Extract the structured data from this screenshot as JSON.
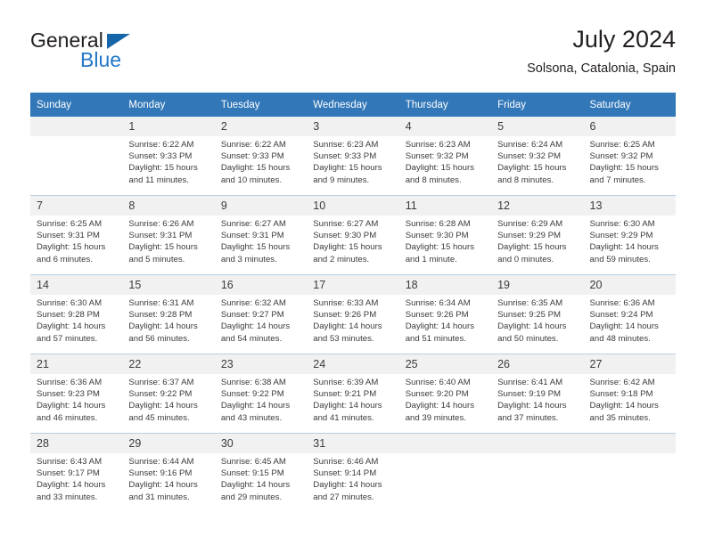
{
  "brand": {
    "name_part1": "General",
    "name_part2": "Blue"
  },
  "header": {
    "title": "July 2024",
    "subtitle": "Solsona, Catalonia, Spain"
  },
  "colors": {
    "header_blue": "#3277b8",
    "logo_blue": "#2277c8",
    "daynum_band": "#f1f1f1",
    "row_divider": "#b9cfe2"
  },
  "weekday_headers": [
    "Sunday",
    "Monday",
    "Tuesday",
    "Wednesday",
    "Thursday",
    "Friday",
    "Saturday"
  ],
  "weeks": [
    [
      {
        "day": "",
        "sunrise": "",
        "sunset": "",
        "daylight_1": "",
        "daylight_2": ""
      },
      {
        "day": "1",
        "sunrise": "Sunrise: 6:22 AM",
        "sunset": "Sunset: 9:33 PM",
        "daylight_1": "Daylight: 15 hours",
        "daylight_2": "and 11 minutes."
      },
      {
        "day": "2",
        "sunrise": "Sunrise: 6:22 AM",
        "sunset": "Sunset: 9:33 PM",
        "daylight_1": "Daylight: 15 hours",
        "daylight_2": "and 10 minutes."
      },
      {
        "day": "3",
        "sunrise": "Sunrise: 6:23 AM",
        "sunset": "Sunset: 9:33 PM",
        "daylight_1": "Daylight: 15 hours",
        "daylight_2": "and 9 minutes."
      },
      {
        "day": "4",
        "sunrise": "Sunrise: 6:23 AM",
        "sunset": "Sunset: 9:32 PM",
        "daylight_1": "Daylight: 15 hours",
        "daylight_2": "and 8 minutes."
      },
      {
        "day": "5",
        "sunrise": "Sunrise: 6:24 AM",
        "sunset": "Sunset: 9:32 PM",
        "daylight_1": "Daylight: 15 hours",
        "daylight_2": "and 8 minutes."
      },
      {
        "day": "6",
        "sunrise": "Sunrise: 6:25 AM",
        "sunset": "Sunset: 9:32 PM",
        "daylight_1": "Daylight: 15 hours",
        "daylight_2": "and 7 minutes."
      }
    ],
    [
      {
        "day": "7",
        "sunrise": "Sunrise: 6:25 AM",
        "sunset": "Sunset: 9:31 PM",
        "daylight_1": "Daylight: 15 hours",
        "daylight_2": "and 6 minutes."
      },
      {
        "day": "8",
        "sunrise": "Sunrise: 6:26 AM",
        "sunset": "Sunset: 9:31 PM",
        "daylight_1": "Daylight: 15 hours",
        "daylight_2": "and 5 minutes."
      },
      {
        "day": "9",
        "sunrise": "Sunrise: 6:27 AM",
        "sunset": "Sunset: 9:31 PM",
        "daylight_1": "Daylight: 15 hours",
        "daylight_2": "and 3 minutes."
      },
      {
        "day": "10",
        "sunrise": "Sunrise: 6:27 AM",
        "sunset": "Sunset: 9:30 PM",
        "daylight_1": "Daylight: 15 hours",
        "daylight_2": "and 2 minutes."
      },
      {
        "day": "11",
        "sunrise": "Sunrise: 6:28 AM",
        "sunset": "Sunset: 9:30 PM",
        "daylight_1": "Daylight: 15 hours",
        "daylight_2": "and 1 minute."
      },
      {
        "day": "12",
        "sunrise": "Sunrise: 6:29 AM",
        "sunset": "Sunset: 9:29 PM",
        "daylight_1": "Daylight: 15 hours",
        "daylight_2": "and 0 minutes."
      },
      {
        "day": "13",
        "sunrise": "Sunrise: 6:30 AM",
        "sunset": "Sunset: 9:29 PM",
        "daylight_1": "Daylight: 14 hours",
        "daylight_2": "and 59 minutes."
      }
    ],
    [
      {
        "day": "14",
        "sunrise": "Sunrise: 6:30 AM",
        "sunset": "Sunset: 9:28 PM",
        "daylight_1": "Daylight: 14 hours",
        "daylight_2": "and 57 minutes."
      },
      {
        "day": "15",
        "sunrise": "Sunrise: 6:31 AM",
        "sunset": "Sunset: 9:28 PM",
        "daylight_1": "Daylight: 14 hours",
        "daylight_2": "and 56 minutes."
      },
      {
        "day": "16",
        "sunrise": "Sunrise: 6:32 AM",
        "sunset": "Sunset: 9:27 PM",
        "daylight_1": "Daylight: 14 hours",
        "daylight_2": "and 54 minutes."
      },
      {
        "day": "17",
        "sunrise": "Sunrise: 6:33 AM",
        "sunset": "Sunset: 9:26 PM",
        "daylight_1": "Daylight: 14 hours",
        "daylight_2": "and 53 minutes."
      },
      {
        "day": "18",
        "sunrise": "Sunrise: 6:34 AM",
        "sunset": "Sunset: 9:26 PM",
        "daylight_1": "Daylight: 14 hours",
        "daylight_2": "and 51 minutes."
      },
      {
        "day": "19",
        "sunrise": "Sunrise: 6:35 AM",
        "sunset": "Sunset: 9:25 PM",
        "daylight_1": "Daylight: 14 hours",
        "daylight_2": "and 50 minutes."
      },
      {
        "day": "20",
        "sunrise": "Sunrise: 6:36 AM",
        "sunset": "Sunset: 9:24 PM",
        "daylight_1": "Daylight: 14 hours",
        "daylight_2": "and 48 minutes."
      }
    ],
    [
      {
        "day": "21",
        "sunrise": "Sunrise: 6:36 AM",
        "sunset": "Sunset: 9:23 PM",
        "daylight_1": "Daylight: 14 hours",
        "daylight_2": "and 46 minutes."
      },
      {
        "day": "22",
        "sunrise": "Sunrise: 6:37 AM",
        "sunset": "Sunset: 9:22 PM",
        "daylight_1": "Daylight: 14 hours",
        "daylight_2": "and 45 minutes."
      },
      {
        "day": "23",
        "sunrise": "Sunrise: 6:38 AM",
        "sunset": "Sunset: 9:22 PM",
        "daylight_1": "Daylight: 14 hours",
        "daylight_2": "and 43 minutes."
      },
      {
        "day": "24",
        "sunrise": "Sunrise: 6:39 AM",
        "sunset": "Sunset: 9:21 PM",
        "daylight_1": "Daylight: 14 hours",
        "daylight_2": "and 41 minutes."
      },
      {
        "day": "25",
        "sunrise": "Sunrise: 6:40 AM",
        "sunset": "Sunset: 9:20 PM",
        "daylight_1": "Daylight: 14 hours",
        "daylight_2": "and 39 minutes."
      },
      {
        "day": "26",
        "sunrise": "Sunrise: 6:41 AM",
        "sunset": "Sunset: 9:19 PM",
        "daylight_1": "Daylight: 14 hours",
        "daylight_2": "and 37 minutes."
      },
      {
        "day": "27",
        "sunrise": "Sunrise: 6:42 AM",
        "sunset": "Sunset: 9:18 PM",
        "daylight_1": "Daylight: 14 hours",
        "daylight_2": "and 35 minutes."
      }
    ],
    [
      {
        "day": "28",
        "sunrise": "Sunrise: 6:43 AM",
        "sunset": "Sunset: 9:17 PM",
        "daylight_1": "Daylight: 14 hours",
        "daylight_2": "and 33 minutes."
      },
      {
        "day": "29",
        "sunrise": "Sunrise: 6:44 AM",
        "sunset": "Sunset: 9:16 PM",
        "daylight_1": "Daylight: 14 hours",
        "daylight_2": "and 31 minutes."
      },
      {
        "day": "30",
        "sunrise": "Sunrise: 6:45 AM",
        "sunset": "Sunset: 9:15 PM",
        "daylight_1": "Daylight: 14 hours",
        "daylight_2": "and 29 minutes."
      },
      {
        "day": "31",
        "sunrise": "Sunrise: 6:46 AM",
        "sunset": "Sunset: 9:14 PM",
        "daylight_1": "Daylight: 14 hours",
        "daylight_2": "and 27 minutes."
      },
      {
        "day": "",
        "sunrise": "",
        "sunset": "",
        "daylight_1": "",
        "daylight_2": ""
      },
      {
        "day": "",
        "sunrise": "",
        "sunset": "",
        "daylight_1": "",
        "daylight_2": ""
      },
      {
        "day": "",
        "sunrise": "",
        "sunset": "",
        "daylight_1": "",
        "daylight_2": ""
      }
    ]
  ]
}
